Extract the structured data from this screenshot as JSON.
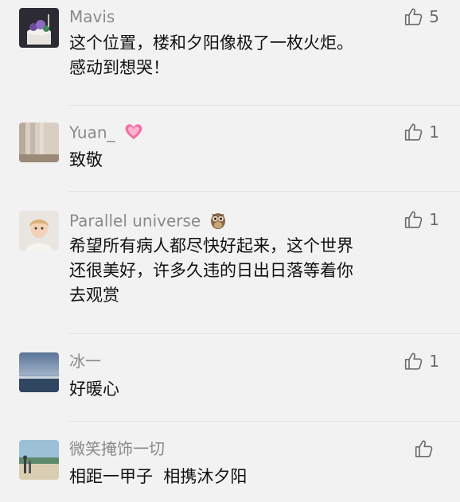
{
  "comments": [
    {
      "author": "Mavis",
      "likes": "5",
      "lines": [
        "这个位置，楼和夕阳像极了一枚火炬。",
        "感动到想哭！"
      ],
      "avatar": "avatar-dark-cake",
      "emoji": ""
    },
    {
      "author": "Yuan_",
      "likes": "1",
      "lines": [
        "致敬"
      ],
      "avatar": "avatar-curtain",
      "emoji": "sparkling-heart-icon"
    },
    {
      "author": "Parallel universe",
      "likes": "1",
      "lines": [
        "希望所有病人都尽快好起来，这个世界",
        "还很美好，许多久违的日出日落等着你",
        "去观赏"
      ],
      "avatar": "avatar-child",
      "emoji": "owl-icon"
    },
    {
      "author": "冰一",
      "likes": "1",
      "lines": [
        "好暖心"
      ],
      "avatar": "avatar-sea-sky",
      "emoji": ""
    },
    {
      "author": "微笑掩饰一切",
      "likes": "",
      "lines": [
        "相距一甲子  相携沐夕阳"
      ],
      "avatar": "avatar-beach",
      "emoji": ""
    }
  ],
  "colors": {
    "background": "#f2f2f2",
    "name": "#8a8a8a",
    "text": "#111111",
    "like": "#6b6b6b"
  }
}
